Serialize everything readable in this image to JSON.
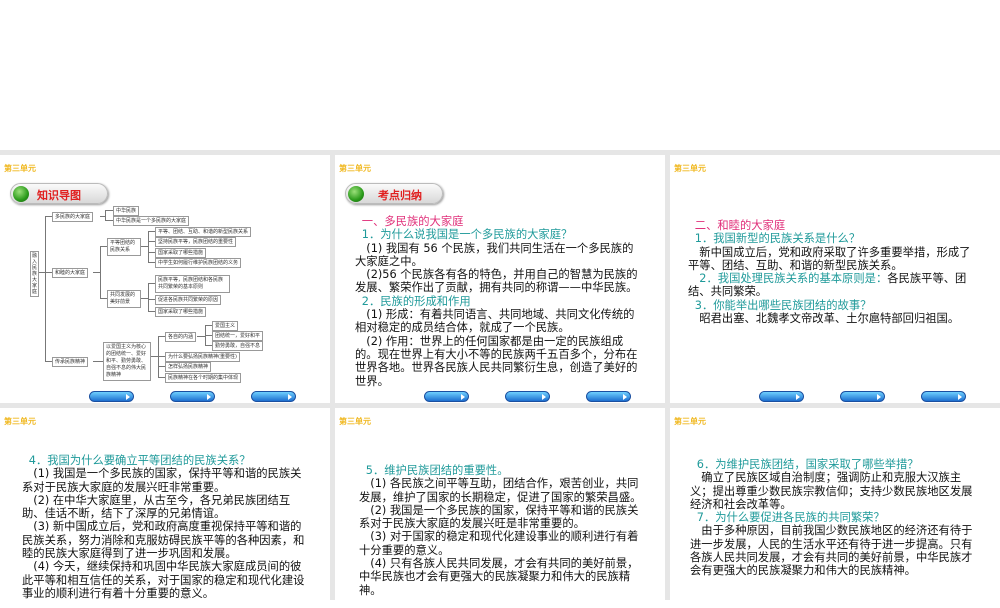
{
  "unit_label": "第三单元",
  "nav_buttons": [
    "nav-button-1",
    "nav-button-2",
    "nav-button-3"
  ],
  "slides": {
    "s1": {
      "title": "知识导图",
      "mindmap": {
        "root": "融入民族大家庭",
        "b1": "多民族的大家庭",
        "b1c1": "中华民族",
        "b1c2": "中华民族是一个多民族的大家庭",
        "b2": "和睦的大家庭",
        "b2a": "平等团结的民族关系",
        "b2a1": "平等、团结、互助、和谐的新型民族关系",
        "b2a2": "坚持民族平等，民族团结的重要性",
        "b2a3": "国家采取了哪些措施",
        "b2a4": "中学生如何履行维护民族团结的义务",
        "b2b": "共同发展的美好前景",
        "b2b1": "民族平等，民族团结和各民族共同繁荣的基本原则",
        "b2b2": "促进各民族共同繁荣的原因",
        "b2b3": "国家采取了哪些措施",
        "b3": "传承民族精神",
        "b3x": "以爱国主义为核心的团结统一、爱好和平、勤劳勇敢、自强不息的伟大民族精神",
        "b3a": "各自的内涵",
        "b3a1": "爱国主义",
        "b3a2": "团结统一，爱好和平",
        "b3a3": "勤劳勇敢，自强不息",
        "b3b": "为什么要弘扬民族精神(重要性)",
        "b3c": "怎样弘扬民族精神",
        "b3d": "民族精神在各个时期的集中体现"
      }
    },
    "s2": {
      "title": "考点归纳",
      "paras": [
        "一、多民族的大家庭",
        "1．为什么说我国是一个多民族的大家庭？",
        "(1) 我国有 56 个民族，我们共同生活在一个多民族的大家庭之中。",
        "(2)56 个民族各有各的特色，并用自己的智慧为民族的发展、繁荣作出了贡献，拥有共同的称谓——中华民族。",
        "2．民族的形成和作用",
        "(1) 形成：有着共同语言、共同地域、共同文化传统的相对稳定的成员结合体，就成了一个民族。",
        "(2) 作用：世界上的任何国家都是由一定的民族组成的。现在世界上有大小不等的民族两千五百多个，分布在世界各地。世界各民族人民共同繁衍生息，创造了美好的世界。"
      ]
    },
    "s3": {
      "paras": [
        "二、和睦的大家庭",
        "1．我国新型的民族关系是什么？",
        "新中国成立后，党和政府采取了许多重要举措，形成了平等、团结、互助、和谐的新型民族关系。",
        "2．我国处理民族关系的基本原则是：",
        "各民族平等、团结、共同繁荣。",
        "3．你能举出哪些民族团结的故事？",
        "昭君出塞、北魏孝文帝改革、土尔扈特部回归祖国。"
      ]
    },
    "s4": {
      "paras": [
        "4．我国为什么要确立平等团结的民族关系？",
        "(1) 我国是一个多民族的国家，保持平等和谐的民族关系对于民族大家庭的发展兴旺非常重要。",
        "(2) 在中华大家庭里，从古至今，各兄弟民族团结互助、佳话不断，结下了深厚的兄弟情谊。",
        "(3) 新中国成立后，党和政府高度重视保持平等和谐的民族关系，努力消除和克服妨碍民族平等的各种因素，和睦的民族大家庭得到了进一步巩固和发展。",
        "(4) 今天，继续保持和巩固中华民族大家庭成员间的彼此平等和相互信任的关系，对于国家的稳定和现代化建设事业的顺利进行有着十分重要的意义。"
      ]
    },
    "s5": {
      "paras": [
        "5．维护民族团结的重要性。",
        "(1) 各民族之间平等互助，团结合作，艰苦创业，共同发展，维护了国家的长期稳定，促进了国家的繁荣昌盛。",
        "(2) 我国是一个多民族的国家，保持平等和谐的民族关系对于民族大家庭的发展兴旺是非常重要的。",
        "(3) 对于国家的稳定和现代化建设事业的顺利进行有着十分重要的意义。",
        "(4) 只有各族人民共同发展，才会有共同的美好前景，中华民族也才会有更强大的民族凝聚力和伟大的民族精神。"
      ]
    },
    "s6": {
      "paras": [
        "6．为维护民族团结，国家采取了哪些举措？",
        "确立了民族区域自治制度；强调防止和克服大汉族主义；提出尊重少数民族宗教信仰；支持少数民族地区发展经济和社会改革等。",
        "7．为什么要促进各民族的共同繁荣？",
        "由于多种原因，目前我国少数民族地区的经济还有待于进一步发展，人民的生活水平还有待于进一步提高。只有各族人民共同发展，才会有共同的美好前景，中华民族才会有更强大的民族凝聚力和伟大的民族精神。"
      ]
    }
  }
}
